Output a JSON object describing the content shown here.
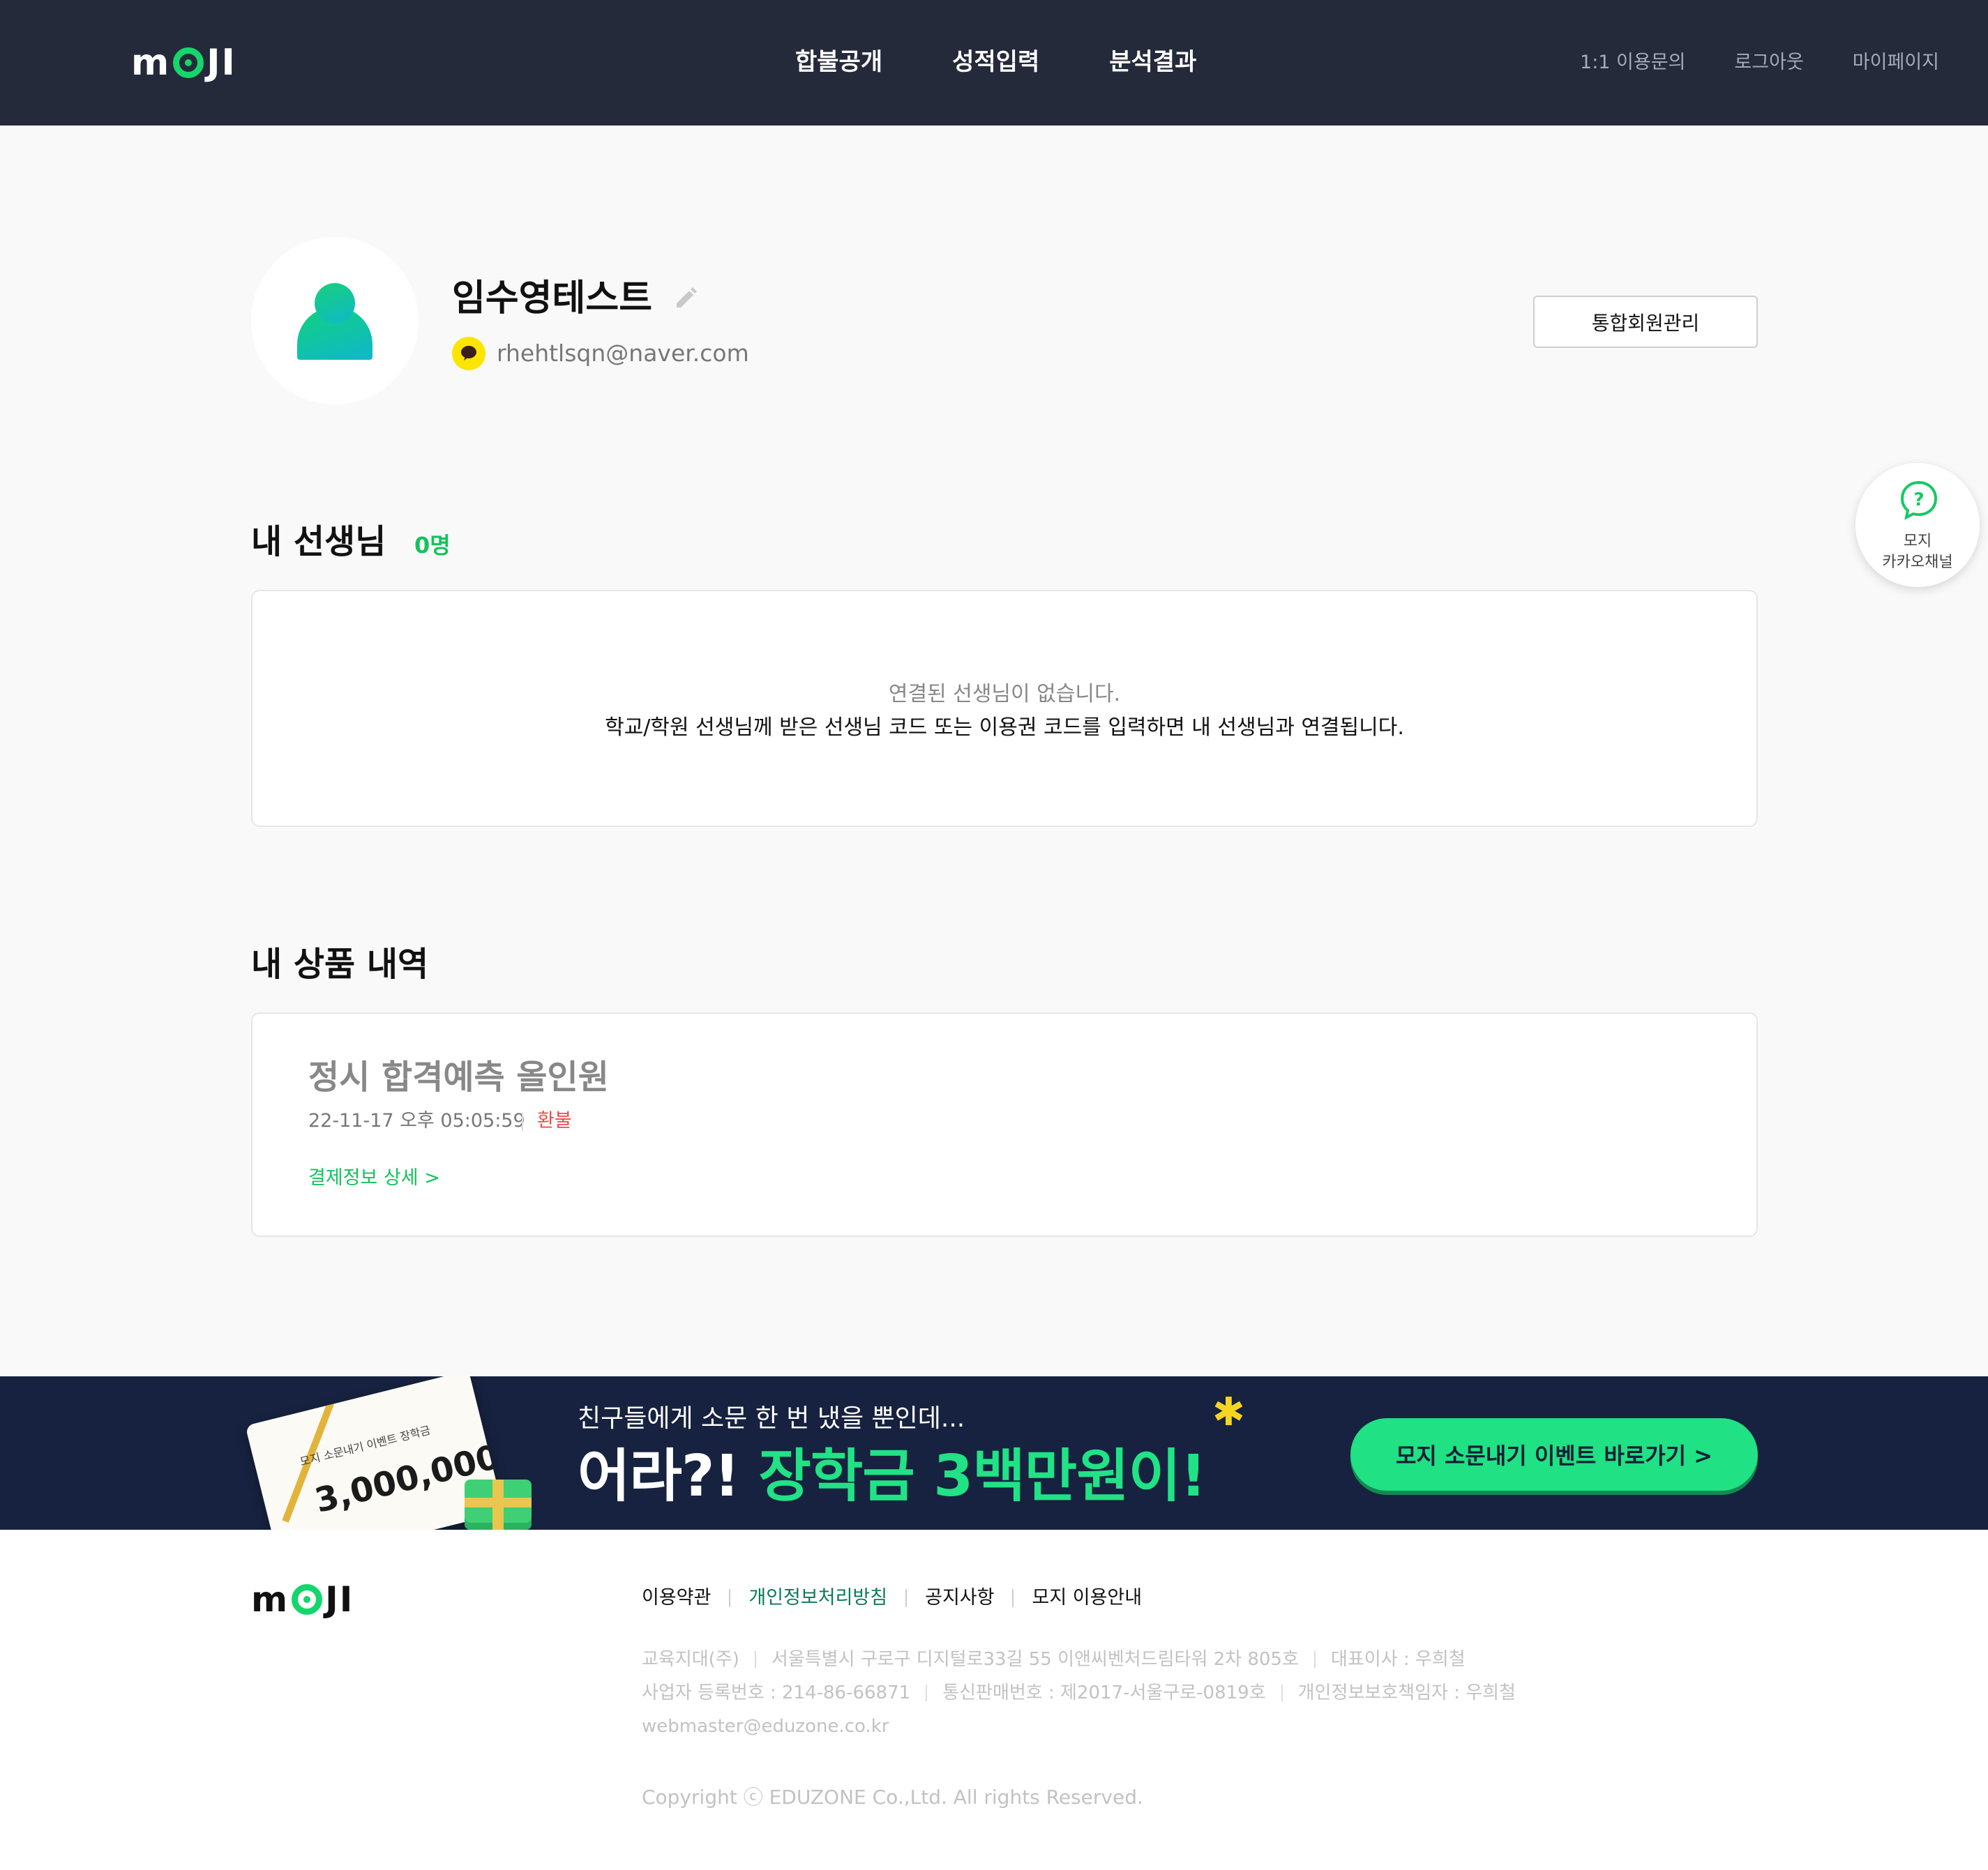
{
  "header": {
    "logo": {
      "m": "m",
      "o": "",
      "ji": "JI"
    },
    "nav": [
      "합불공개",
      "성적입력",
      "분석결과"
    ],
    "sub_nav": [
      "1:1 이용문의",
      "로그아웃",
      "마이페이지"
    ]
  },
  "profile": {
    "name": "임수영테스트",
    "email": "rhehtlsqn@naver.com",
    "manage_button": "통합회원관리"
  },
  "float_channel": {
    "line1": "모지",
    "line2": "카카오채널"
  },
  "teachers": {
    "title": "내 선생님",
    "count": "0명",
    "empty_line1": "연결된 선생님이 없습니다.",
    "empty_line2": "학교/학원 선생님께 받은 선생님 코드 또는 이용권 코드를 입력하면 내 선생님과 연결됩니다."
  },
  "products": {
    "title": "내 상품 내역",
    "items": [
      {
        "name": "정시 합격예측 올인원",
        "date": "22-11-17 오후 05:05:59",
        "status": "환불",
        "detail_link": "결제정보 상세 >"
      }
    ]
  },
  "banner": {
    "ticket_label": "모지 소문내기 이벤트 장학금",
    "ticket_amount": "3,000,000",
    "sub": "친구들에게 소문 한 번 냈을 뿐인데...",
    "main_white": "어라?! ",
    "main_green": "장학금 3백만원이!",
    "button": "모지 소문내기 이벤트 바로가기 >"
  },
  "footer": {
    "links": [
      "이용약관",
      "개인정보처리방침",
      "공지사항",
      "모지 이용안내"
    ],
    "company": "교육지대(주)",
    "address": "서울특별시 구로구 디지털로33길 55 이앤씨벤처드림타워 2차 805호",
    "ceo": "대표이사 : 우희철",
    "biz_no": "사업자 등록번호 : 214-86-66871",
    "mail_order_no": "통신판매번호 : 제2017-서울구로-0819호",
    "privacy_officer": "개인정보보호책임자 : 우희철",
    "email": "webmaster@eduzone.co.kr",
    "copyright": "Copyright ⓒ EDUZONE Co.,Ltd. All rights Reserved."
  },
  "colors": {
    "header_bg": "#252a3b",
    "brand_green": "#14c35c",
    "banner_bg": "#16223f",
    "refund_red": "#f04a4a"
  }
}
